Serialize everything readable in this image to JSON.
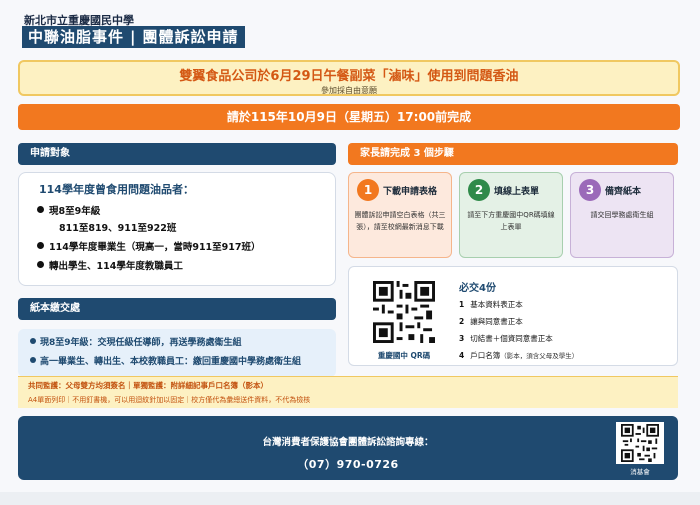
{
  "header": {
    "school": "新北市立重慶國民中學",
    "title_left": "中聯油脂事件",
    "title_sep": "|",
    "title_right": "團體訴訟申請"
  },
  "headline": {
    "main": "雙翼食品公司於6月29日午餐副菜「滷味」使用到問題香油",
    "sub": "參加採自由意願"
  },
  "deadline": "請於115年10月9日（星期五）17:00前完成",
  "eligibility": {
    "heading": "申請對象",
    "title": "114學年度曾食用問題油品者：",
    "items": [
      "現8至9年級",
      "114學年度畢業生（現高一，當時911至917班）",
      "轉出學生、114學年度教職員工"
    ],
    "classes": "811至819、911至922班"
  },
  "paper": {
    "heading": "紙本繳交處",
    "lines": [
      "現8至9年級：交現任級任導師，再送學務處衛生組",
      "高一畢業生、轉出生、本校教職員工：繳回重慶國中學務處衛生組"
    ]
  },
  "steps": {
    "heading": "家長請完成 3 個步驟",
    "items": [
      {
        "num": "1",
        "title": "下載申請表格",
        "desc": "團體訴訟申請空白表格（共三張），請至校網最新消息下載"
      },
      {
        "num": "2",
        "title": "填線上表單",
        "desc": "請至下方重慶國中QR碼填線上表單"
      },
      {
        "num": "3",
        "title": "備齊紙本",
        "desc": "請交回學務處衛生組"
      }
    ]
  },
  "submit": {
    "qr_label": "重慶國中 QR碼",
    "title": "必交4份",
    "items": [
      {
        "n": "1",
        "text": "基本資料表正本",
        "note": ""
      },
      {
        "n": "2",
        "text": "讓與同意書正本",
        "note": ""
      },
      {
        "n": "3",
        "text": "切結書＋個資同意書正本",
        "note": ""
      },
      {
        "n": "4",
        "text": "戶口名簿",
        "note": "（影本，須含父母及學生）"
      }
    ]
  },
  "notes": {
    "line1": "共同監護：父母雙方均須簽名｜單獨監護：附詳細記事戶口名簿（影本）",
    "line2": "A4單面列印｜不用釘書機，可以用迴紋針加以固定｜校方僅代為彙總送件資料，不代為檢核"
  },
  "footer": {
    "hotline_label": "台灣消費者保護協會團體訴訟諮詢專線：",
    "phone": "（07）970-0726",
    "qr_label": "消基會"
  },
  "colors": {
    "navy": "#1f4a70",
    "orange": "#f2781f",
    "cream": "#fdf1c2"
  }
}
